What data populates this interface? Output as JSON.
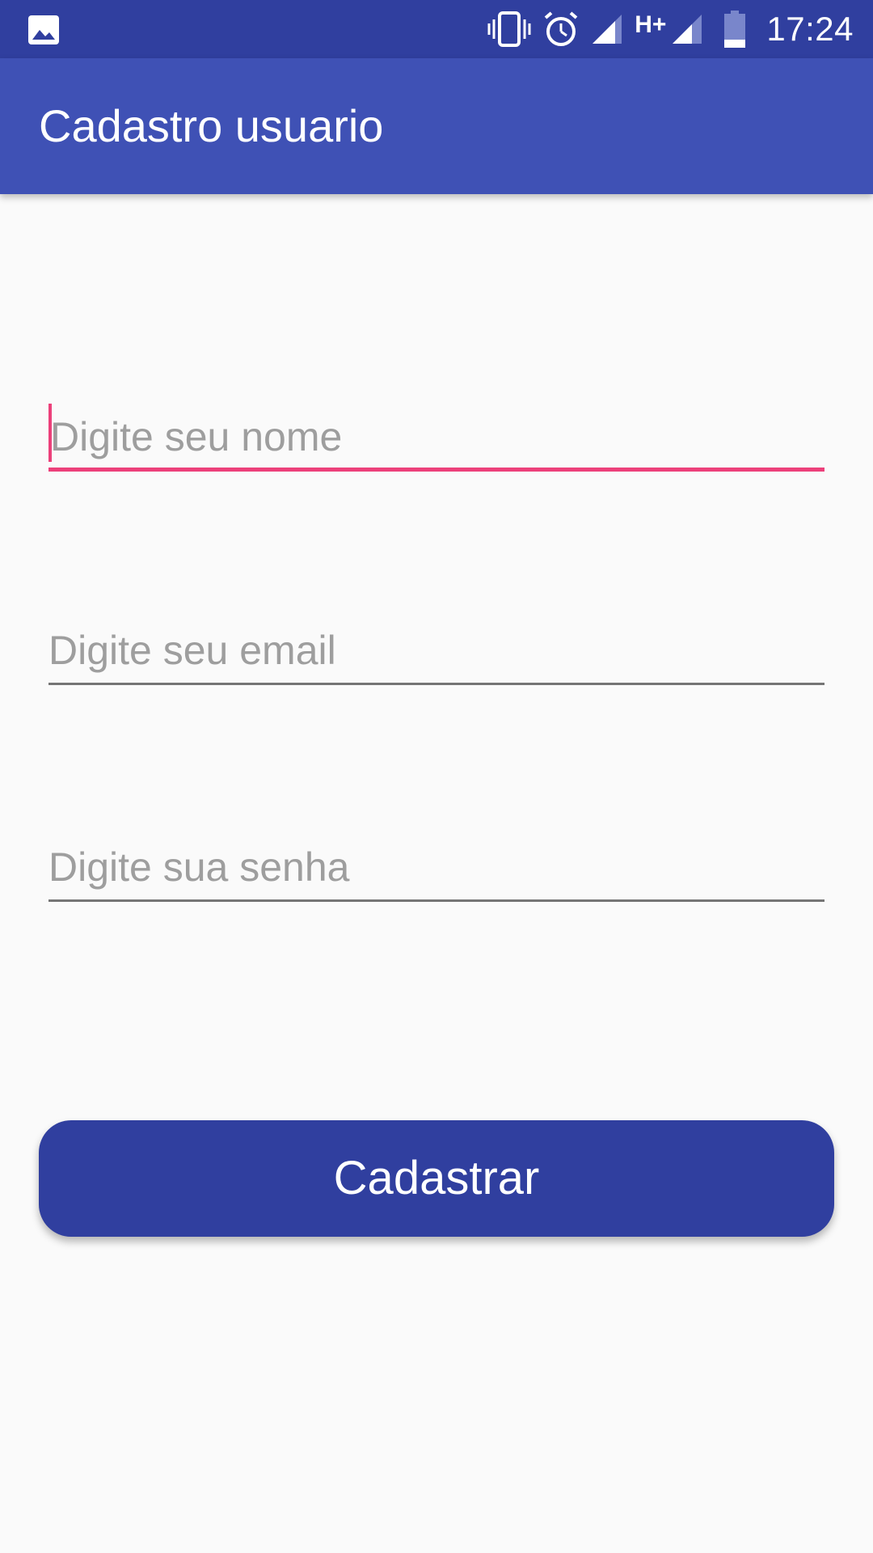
{
  "status_bar": {
    "time": "17:24",
    "network_label": "H+",
    "icons": [
      "image-icon",
      "vibrate-icon",
      "alarm-icon",
      "signal-icon",
      "signal-icon",
      "battery-icon"
    ],
    "background_color": "#303f9f"
  },
  "app_bar": {
    "title": "Cadastro usuario",
    "background_color": "#3f51b5"
  },
  "form": {
    "name_field": {
      "value": "",
      "placeholder": "Digite seu nome",
      "focused": true
    },
    "email_field": {
      "value": "",
      "placeholder": "Digite seu email",
      "focused": false
    },
    "password_field": {
      "value": "",
      "placeholder": "Digite sua senha",
      "focused": false
    },
    "accent_color": "#ec407a"
  },
  "submit_button": {
    "label": "Cadastrar",
    "background_color": "#303f9f"
  }
}
